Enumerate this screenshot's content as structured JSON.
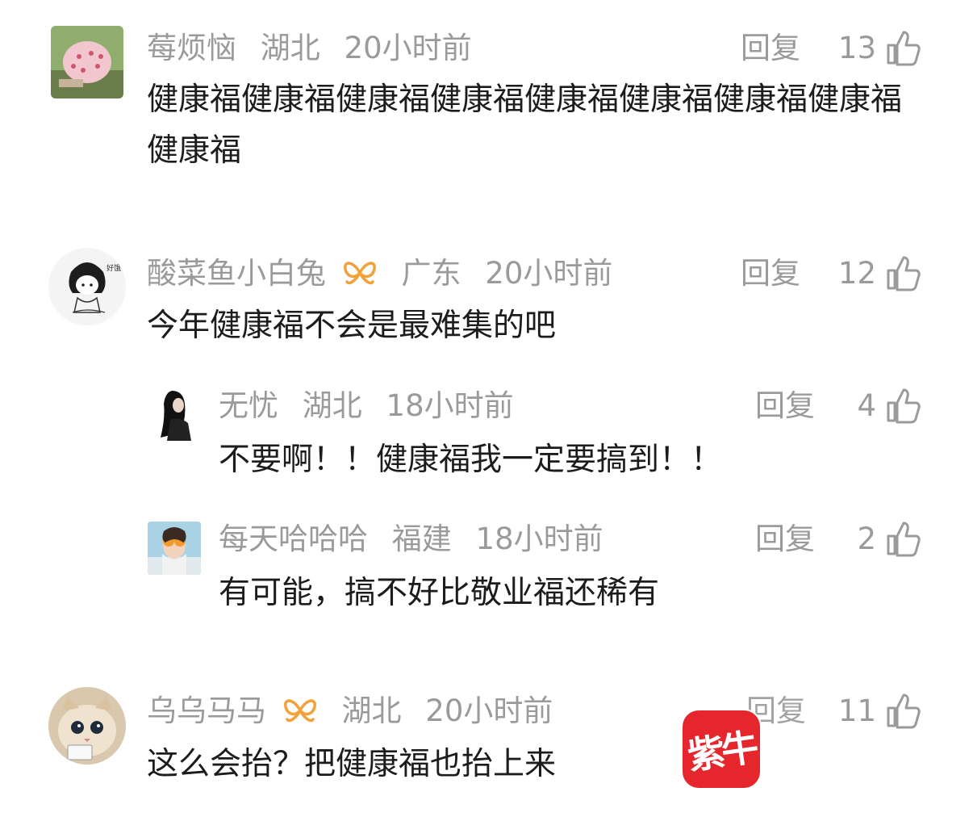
{
  "comments": [
    {
      "user": "莓烦恼",
      "location": "湖北",
      "time": "20小时前",
      "reply_label": "回复",
      "likes": "13",
      "text": "健康福健康福健康福健康福健康福健康福健康福健康福健康福"
    },
    {
      "user": "酸菜鱼小白兔",
      "vip": true,
      "location": "广东",
      "time": "20小时前",
      "reply_label": "回复",
      "likes": "12",
      "text": "今年健康福不会是最难集的吧",
      "avatar_caption": "好饿",
      "replies": [
        {
          "user": "无忧",
          "location": "湖北",
          "time": "18小时前",
          "reply_label": "回复",
          "likes": "4",
          "text": "不要啊！！健康福我一定要搞到！！"
        },
        {
          "user": "每天哈哈哈",
          "location": "福建",
          "time": "18小时前",
          "reply_label": "回复",
          "likes": "2",
          "text": "有可能，搞不好比敬业福还稀有"
        }
      ]
    },
    {
      "user": "乌乌马马",
      "vip": true,
      "location": "湖北",
      "time": "20小时前",
      "reply_label": "回复",
      "likes": "11",
      "text": "这么会抬？把健康福也抬上来"
    }
  ],
  "watermark": {
    "text": "紫牛",
    "color": "#e5262c"
  },
  "colors": {
    "meta": "#9a9a9a",
    "text": "#1c1c1c",
    "vip": "#f2a23a"
  }
}
